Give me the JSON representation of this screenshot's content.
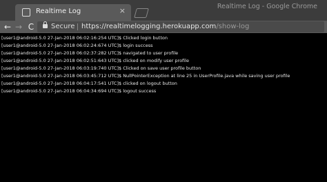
{
  "browser": {
    "window_title": "Realtime Log - Google Chrome",
    "tab": {
      "title": "Realtime Log",
      "close_glyph": "×"
    },
    "nav": {
      "back_glyph": "←",
      "forward_glyph": "→",
      "reload_glyph": "C"
    },
    "omnibox": {
      "security_label": "Secure",
      "url_scheme_host": "https://realtimelogging.herokuapp.com",
      "url_path": "/show-log"
    }
  },
  "log": {
    "lines": [
      "[user1@android-5.0 27-Jan-2018 06:02:16:254 UTC]$ Clicked login button",
      "[user1@android-5.0 27-Jan-2018 06:02:24:674 UTC]$ login success",
      "[user1@android-5.0 27-Jan-2018 06:02:37:282 UTC]$ navigated to user profile",
      "[user1@android-5.0 27-Jan-2018 06:02:51:643 UTC]$ clicked on modify user profile",
      "[user1@android-5.0 27-Jan-2018 06:03:19:740 UTC]$ Clicked on save user profile button",
      "[user1@android-5.0 27-Jan-2018 06:03:45:712 UTC]$ NullPointerException at line 25 in UserProfile.java while saving user profile",
      "[user1@android-5.0 27-Jan-2018 06:04:17:541 UTC]$ clicked on logout button",
      "[user1@android-5.0 27-Jan-2018 06:04:34:694 UTC]$ logout success"
    ]
  }
}
